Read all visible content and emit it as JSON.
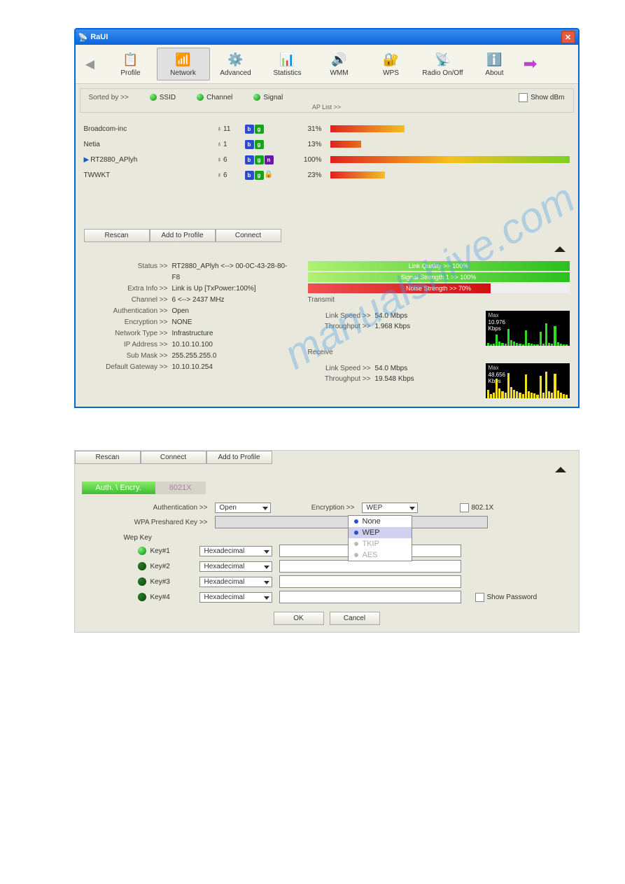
{
  "window": {
    "title": "RaUI"
  },
  "toolbar": {
    "items": [
      {
        "label": "Profile"
      },
      {
        "label": "Network"
      },
      {
        "label": "Advanced"
      },
      {
        "label": "Statistics"
      },
      {
        "label": "WMM"
      },
      {
        "label": "WPS"
      },
      {
        "label": "Radio On/Off"
      },
      {
        "label": "About"
      }
    ]
  },
  "sort": {
    "label": "Sorted by >>",
    "ssid": "SSID",
    "channel": "Channel",
    "signal": "Signal",
    "showdbm": "Show dBm",
    "aplist": "AP List >>"
  },
  "networks": [
    {
      "name": "Broadcom-inc",
      "channel": "11",
      "modes": [
        "b",
        "g"
      ],
      "lock": false,
      "percent": "31%",
      "signal": 31,
      "selected": false
    },
    {
      "name": "Netia",
      "channel": "1",
      "modes": [
        "b",
        "g"
      ],
      "lock": false,
      "percent": "13%",
      "signal": 13,
      "selected": false
    },
    {
      "name": "RT2880_APlyh",
      "channel": "6",
      "modes": [
        "b",
        "g",
        "n"
      ],
      "lock": false,
      "percent": "100%",
      "signal": 100,
      "selected": true
    },
    {
      "name": "TWWKT",
      "channel": "6",
      "modes": [
        "b",
        "g"
      ],
      "lock": true,
      "percent": "23%",
      "signal": 23,
      "selected": false
    }
  ],
  "buttons": {
    "rescan": "Rescan",
    "addprofile": "Add to Profile",
    "connect": "Connect"
  },
  "status": {
    "rows": [
      {
        "k": "Status >>",
        "v": "RT2880_APlyh <--> 00-0C-43-28-80-F8"
      },
      {
        "k": "Extra Info >>",
        "v": "Link is Up [TxPower:100%]"
      },
      {
        "k": "Channel >>",
        "v": "6 <--> 2437 MHz"
      },
      {
        "k": "Authentication >>",
        "v": "Open"
      },
      {
        "k": "Encryption >>",
        "v": "NONE"
      },
      {
        "k": "Network Type >>",
        "v": "Infrastructure"
      },
      {
        "k": "IP Address >>",
        "v": "10.10.10.100"
      },
      {
        "k": "Sub Mask >>",
        "v": "255.255.255.0"
      },
      {
        "k": "Default Gateway >>",
        "v": "10.10.10.254"
      }
    ]
  },
  "quality": {
    "link": {
      "label": "Link Quality >> 100%",
      "pct": 100
    },
    "signal": {
      "label": "Signal Strength 1 >> 100%",
      "pct": 100
    },
    "noise": {
      "label": "Noise Strength >> 70%",
      "pct": 70
    }
  },
  "transmit": {
    "title": "Transmit",
    "linkspeed_k": "Link Speed >>",
    "linkspeed_v": "54.0 Mbps",
    "throughput_k": "Throughput >>",
    "throughput_v": "1.968 Kbps",
    "max": "Max",
    "maxval": "10.976\nKbps"
  },
  "receive": {
    "title": "Receive",
    "linkspeed_k": "Link Speed >>",
    "linkspeed_v": "54.0 Mbps",
    "throughput_k": "Throughput >>",
    "throughput_v": "19.548 Kbps",
    "max": "Max",
    "maxval": "48.656\nKbps"
  },
  "sec_buttons": {
    "rescan": "Rescan",
    "connect": "Connect",
    "addprofile": "Add to Profile"
  },
  "tabs": {
    "auth": "Auth. \\ Encry.",
    "x8021": "8021X"
  },
  "authform": {
    "auth_label": "Authentication >>",
    "auth_value": "Open",
    "enc_label": "Encryption >>",
    "enc_value": "WEP",
    "x8021_label": "802.1X",
    "wpa_label": "WPA Preshared Key >>",
    "wepkey_label": "Wep Key",
    "keys": [
      {
        "label": "Key#1",
        "format": "Hexadecimal",
        "active": true
      },
      {
        "label": "Key#2",
        "format": "Hexadecimal",
        "active": false
      },
      {
        "label": "Key#3",
        "format": "Hexadecimal",
        "active": false
      },
      {
        "label": "Key#4",
        "format": "Hexadecimal",
        "active": false
      }
    ],
    "showpw": "Show Password",
    "ok": "OK",
    "cancel": "Cancel",
    "dropdown": [
      "None",
      "WEP",
      "TKIP",
      "AES"
    ]
  }
}
